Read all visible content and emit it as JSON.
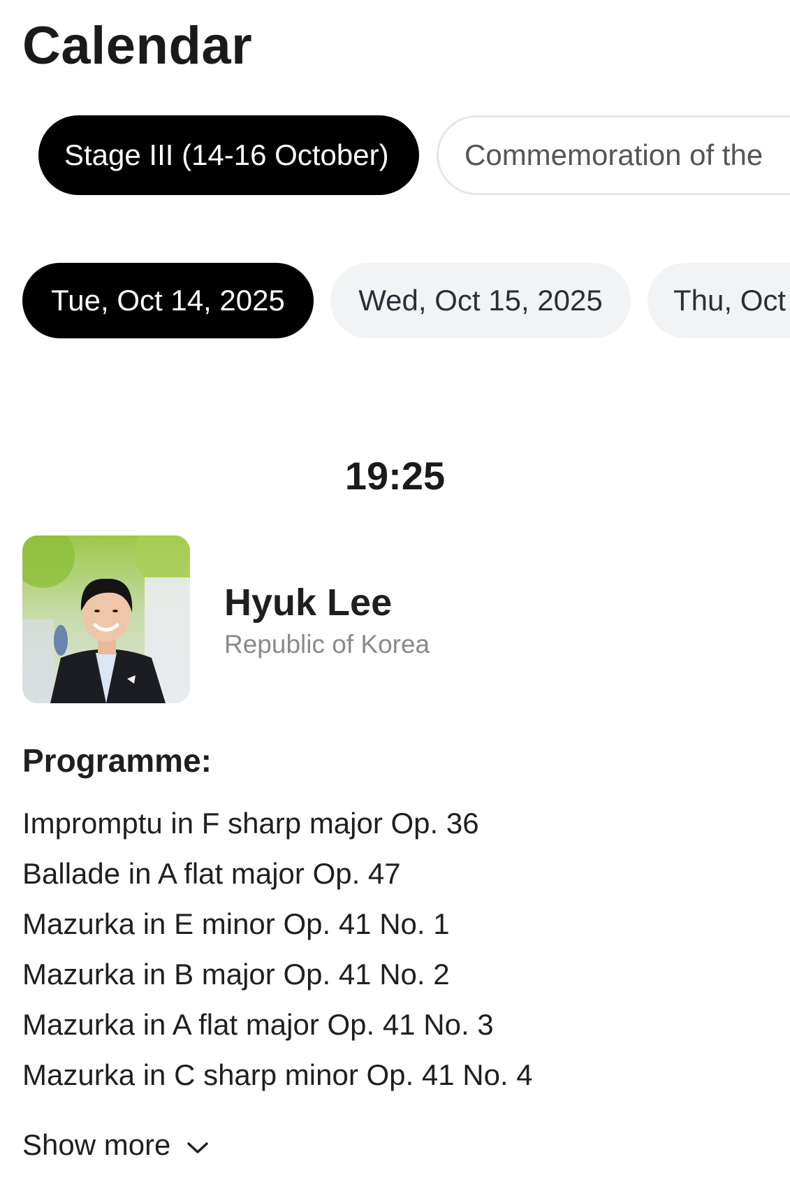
{
  "header": {
    "title": "Calendar"
  },
  "stages": [
    {
      "label": "Stage III (14-16 October)",
      "active": true
    },
    {
      "label": "Commemoration of the",
      "active": false
    }
  ],
  "dates": [
    {
      "label": "Tue, Oct 14, 2025",
      "active": true
    },
    {
      "label": "Wed, Oct 15, 2025",
      "active": false
    },
    {
      "label": "Thu, Oct",
      "active": false
    }
  ],
  "session": {
    "time": "19:25"
  },
  "performer": {
    "name": "Hyuk Lee",
    "country": "Republic of Korea",
    "photo_icon": "performer-photo"
  },
  "programme": {
    "heading": "Programme:",
    "items": [
      "Impromptu in F sharp major Op. 36",
      "Ballade in A flat major Op. 47",
      "Mazurka in E minor Op. 41 No. 1",
      "Mazurka in B major Op. 41 No. 2",
      "Mazurka in A flat major Op. 41 No. 3",
      "Mazurka in C sharp minor Op. 41 No. 4"
    ]
  },
  "show_more": {
    "label": "Show more",
    "icon": "chevron-down-icon"
  },
  "colors": {
    "active_chip_bg": "#000000",
    "inactive_date_chip_bg": "#f2f3f5",
    "secondary_text": "#8a8a8a"
  }
}
